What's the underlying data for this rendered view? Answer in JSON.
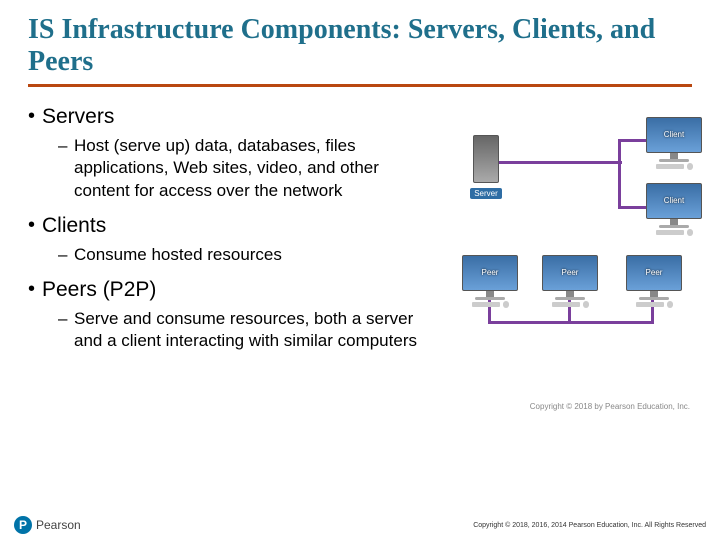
{
  "title": "IS Infrastructure Components: Servers, Clients, and Peers",
  "bullets": {
    "servers": {
      "label": "Servers",
      "sub": "Host (serve up) data, databases, files applications, Web sites, video, and other content for access over the network"
    },
    "clients": {
      "label": "Clients",
      "sub": "Consume hosted resources"
    },
    "peers": {
      "label": "Peers (P2P)",
      "sub": "Serve and consume resources, both a server and a client interacting with similar computers"
    }
  },
  "diagram_labels": {
    "server": "Server",
    "client": "Client",
    "peer": "Peer",
    "fig_copyright": "Copyright © 2018 by Pearson Education, Inc."
  },
  "footer": {
    "logo_letter": "P",
    "logo_text": "Pearson",
    "copyright": "Copyright © 2018, 2016, 2014 Pearson Education, Inc. All Rights Reserved"
  }
}
